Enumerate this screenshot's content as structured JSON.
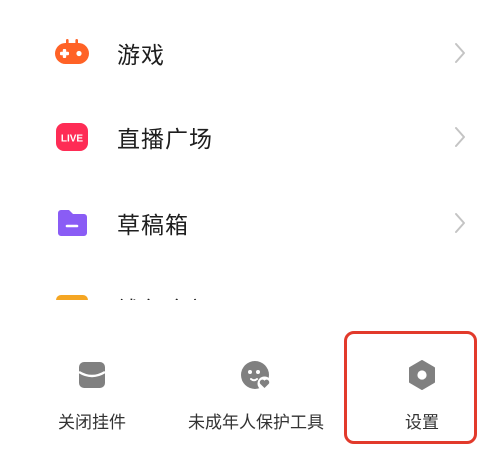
{
  "menu": {
    "items": [
      {
        "label": "游戏",
        "icon": "game-controller-icon"
      },
      {
        "label": "直播广场",
        "icon": "live-icon",
        "badge": "LIVE"
      },
      {
        "label": "草稿箱",
        "icon": "folder-icon"
      }
    ],
    "partial_item": {
      "label": "钱包余额",
      "icon": "wallet-icon"
    }
  },
  "bottom_tools": [
    {
      "label": "关闭挂件",
      "icon": "widget-close-icon"
    },
    {
      "label": "未成年人保护工具",
      "icon": "minor-protection-icon"
    },
    {
      "label": "设置",
      "icon": "settings-icon"
    }
  ],
  "colors": {
    "game": "#ff6226",
    "live": "#fe2c55",
    "folder": "#8a5cf5",
    "wallet": "#f5a623",
    "tool_icon": "#808080",
    "highlight": "#e23a2b",
    "chevron": "#c4c4c4"
  }
}
